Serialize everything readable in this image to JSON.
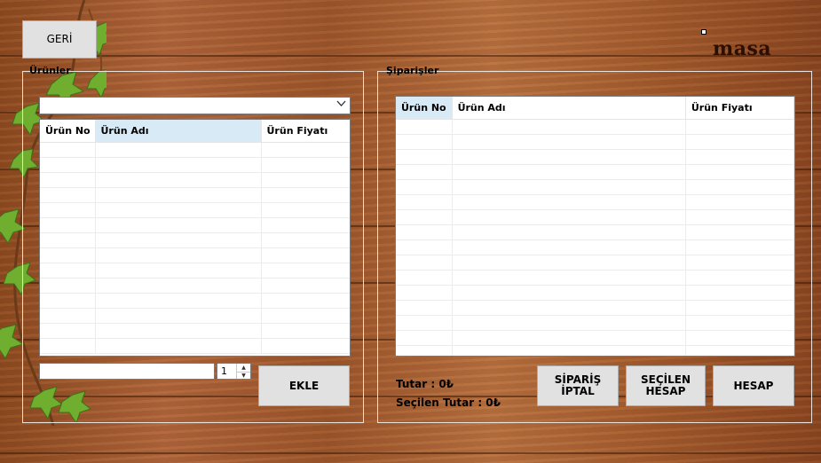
{
  "window": {
    "back_label": "GERİ",
    "brand_text": "masa"
  },
  "urunler": {
    "legend": "Ürünler",
    "combo_value": "",
    "columns": [
      "Ürün No",
      "Ürün Adı",
      "Ürün Fiyatı"
    ],
    "rows": [],
    "quantity_value": "1",
    "add_label": "EKLE"
  },
  "siparisler": {
    "legend": "Şiparişler",
    "columns": [
      "Ürün No",
      "Ürün Adı",
      "Ürün Fiyatı"
    ],
    "rows": [],
    "total_label": "Tutar : 0₺",
    "selected_total_label": "Seçilen Tutar : 0₺",
    "cancel_label": "SİPARİŞ İPTAL",
    "selected_bill_label": "SEÇİLEN HESAP",
    "bill_label": "HESAP"
  }
}
